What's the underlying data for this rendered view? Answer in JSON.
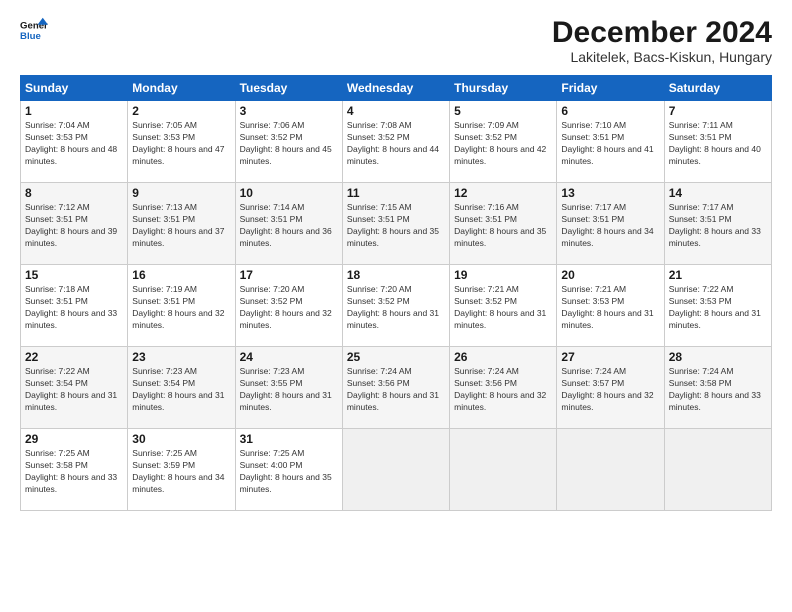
{
  "header": {
    "title": "December 2024",
    "subtitle": "Lakitelek, Bacs-Kiskun, Hungary"
  },
  "calendar": {
    "headers": [
      "Sunday",
      "Monday",
      "Tuesday",
      "Wednesday",
      "Thursday",
      "Friday",
      "Saturday"
    ],
    "rows": [
      [
        {
          "day": "",
          "sunrise": "",
          "sunset": "",
          "daylight": "",
          "empty": true
        },
        {
          "day": "2",
          "sunrise": "Sunrise: 7:05 AM",
          "sunset": "Sunset: 3:53 PM",
          "daylight": "Daylight: 8 hours and 47 minutes."
        },
        {
          "day": "3",
          "sunrise": "Sunrise: 7:06 AM",
          "sunset": "Sunset: 3:52 PM",
          "daylight": "Daylight: 8 hours and 45 minutes."
        },
        {
          "day": "4",
          "sunrise": "Sunrise: 7:08 AM",
          "sunset": "Sunset: 3:52 PM",
          "daylight": "Daylight: 8 hours and 44 minutes."
        },
        {
          "day": "5",
          "sunrise": "Sunrise: 7:09 AM",
          "sunset": "Sunset: 3:52 PM",
          "daylight": "Daylight: 8 hours and 42 minutes."
        },
        {
          "day": "6",
          "sunrise": "Sunrise: 7:10 AM",
          "sunset": "Sunset: 3:51 PM",
          "daylight": "Daylight: 8 hours and 41 minutes."
        },
        {
          "day": "7",
          "sunrise": "Sunrise: 7:11 AM",
          "sunset": "Sunset: 3:51 PM",
          "daylight": "Daylight: 8 hours and 40 minutes."
        }
      ],
      [
        {
          "day": "8",
          "sunrise": "Sunrise: 7:12 AM",
          "sunset": "Sunset: 3:51 PM",
          "daylight": "Daylight: 8 hours and 39 minutes."
        },
        {
          "day": "9",
          "sunrise": "Sunrise: 7:13 AM",
          "sunset": "Sunset: 3:51 PM",
          "daylight": "Daylight: 8 hours and 37 minutes."
        },
        {
          "day": "10",
          "sunrise": "Sunrise: 7:14 AM",
          "sunset": "Sunset: 3:51 PM",
          "daylight": "Daylight: 8 hours and 36 minutes."
        },
        {
          "day": "11",
          "sunrise": "Sunrise: 7:15 AM",
          "sunset": "Sunset: 3:51 PM",
          "daylight": "Daylight: 8 hours and 35 minutes."
        },
        {
          "day": "12",
          "sunrise": "Sunrise: 7:16 AM",
          "sunset": "Sunset: 3:51 PM",
          "daylight": "Daylight: 8 hours and 35 minutes."
        },
        {
          "day": "13",
          "sunrise": "Sunrise: 7:17 AM",
          "sunset": "Sunset: 3:51 PM",
          "daylight": "Daylight: 8 hours and 34 minutes."
        },
        {
          "day": "14",
          "sunrise": "Sunrise: 7:17 AM",
          "sunset": "Sunset: 3:51 PM",
          "daylight": "Daylight: 8 hours and 33 minutes."
        }
      ],
      [
        {
          "day": "15",
          "sunrise": "Sunrise: 7:18 AM",
          "sunset": "Sunset: 3:51 PM",
          "daylight": "Daylight: 8 hours and 33 minutes."
        },
        {
          "day": "16",
          "sunrise": "Sunrise: 7:19 AM",
          "sunset": "Sunset: 3:51 PM",
          "daylight": "Daylight: 8 hours and 32 minutes."
        },
        {
          "day": "17",
          "sunrise": "Sunrise: 7:20 AM",
          "sunset": "Sunset: 3:52 PM",
          "daylight": "Daylight: 8 hours and 32 minutes."
        },
        {
          "day": "18",
          "sunrise": "Sunrise: 7:20 AM",
          "sunset": "Sunset: 3:52 PM",
          "daylight": "Daylight: 8 hours and 31 minutes."
        },
        {
          "day": "19",
          "sunrise": "Sunrise: 7:21 AM",
          "sunset": "Sunset: 3:52 PM",
          "daylight": "Daylight: 8 hours and 31 minutes."
        },
        {
          "day": "20",
          "sunrise": "Sunrise: 7:21 AM",
          "sunset": "Sunset: 3:53 PM",
          "daylight": "Daylight: 8 hours and 31 minutes."
        },
        {
          "day": "21",
          "sunrise": "Sunrise: 7:22 AM",
          "sunset": "Sunset: 3:53 PM",
          "daylight": "Daylight: 8 hours and 31 minutes."
        }
      ],
      [
        {
          "day": "22",
          "sunrise": "Sunrise: 7:22 AM",
          "sunset": "Sunset: 3:54 PM",
          "daylight": "Daylight: 8 hours and 31 minutes."
        },
        {
          "day": "23",
          "sunrise": "Sunrise: 7:23 AM",
          "sunset": "Sunset: 3:54 PM",
          "daylight": "Daylight: 8 hours and 31 minutes."
        },
        {
          "day": "24",
          "sunrise": "Sunrise: 7:23 AM",
          "sunset": "Sunset: 3:55 PM",
          "daylight": "Daylight: 8 hours and 31 minutes."
        },
        {
          "day": "25",
          "sunrise": "Sunrise: 7:24 AM",
          "sunset": "Sunset: 3:56 PM",
          "daylight": "Daylight: 8 hours and 31 minutes."
        },
        {
          "day": "26",
          "sunrise": "Sunrise: 7:24 AM",
          "sunset": "Sunset: 3:56 PM",
          "daylight": "Daylight: 8 hours and 32 minutes."
        },
        {
          "day": "27",
          "sunrise": "Sunrise: 7:24 AM",
          "sunset": "Sunset: 3:57 PM",
          "daylight": "Daylight: 8 hours and 32 minutes."
        },
        {
          "day": "28",
          "sunrise": "Sunrise: 7:24 AM",
          "sunset": "Sunset: 3:58 PM",
          "daylight": "Daylight: 8 hours and 33 minutes."
        }
      ],
      [
        {
          "day": "29",
          "sunrise": "Sunrise: 7:25 AM",
          "sunset": "Sunset: 3:58 PM",
          "daylight": "Daylight: 8 hours and 33 minutes."
        },
        {
          "day": "30",
          "sunrise": "Sunrise: 7:25 AM",
          "sunset": "Sunset: 3:59 PM",
          "daylight": "Daylight: 8 hours and 34 minutes."
        },
        {
          "day": "31",
          "sunrise": "Sunrise: 7:25 AM",
          "sunset": "Sunset: 4:00 PM",
          "daylight": "Daylight: 8 hours and 35 minutes."
        },
        {
          "day": "",
          "sunrise": "",
          "sunset": "",
          "daylight": "",
          "empty": true
        },
        {
          "day": "",
          "sunrise": "",
          "sunset": "",
          "daylight": "",
          "empty": true
        },
        {
          "day": "",
          "sunrise": "",
          "sunset": "",
          "daylight": "",
          "empty": true
        },
        {
          "day": "",
          "sunrise": "",
          "sunset": "",
          "daylight": "",
          "empty": true
        }
      ]
    ],
    "day1": {
      "day": "1",
      "sunrise": "Sunrise: 7:04 AM",
      "sunset": "Sunset: 3:53 PM",
      "daylight": "Daylight: 8 hours and 48 minutes."
    }
  }
}
